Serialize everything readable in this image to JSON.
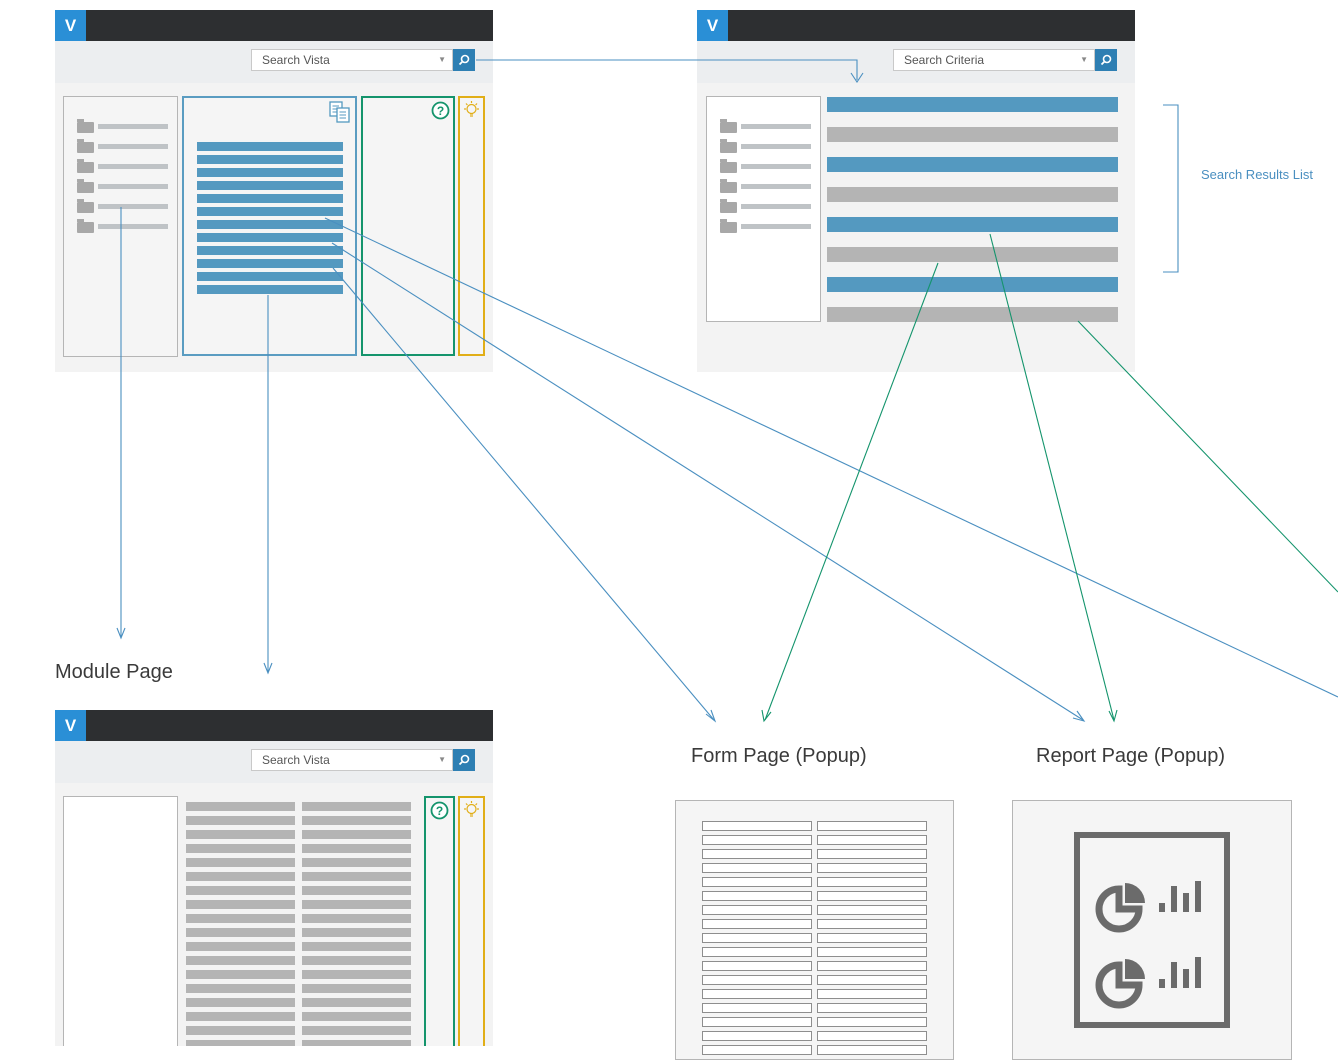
{
  "app": {
    "logo_letter": "V"
  },
  "screens": {
    "main": {
      "search_placeholder": "Search Vista"
    },
    "search": {
      "search_placeholder": "Search Criteria"
    },
    "module": {
      "search_placeholder": "Search Vista"
    }
  },
  "labels": {
    "module_page": "Module Page",
    "form_page": "Form Page (Popup)",
    "report_page": "Report Page (Popup)",
    "search_results_list": "Search Results List"
  },
  "icons": {
    "copy": "copy-pages-icon",
    "help": "help-circle-icon",
    "idea": "lightbulb-icon",
    "search": "magnifier-icon",
    "report": "pie-bar-report-icon"
  },
  "colors": {
    "topbar": "#2d2f31",
    "logo": "#2a8fd6",
    "blue_accent": "#5499c0",
    "green_accent": "#14946c",
    "gold_accent": "#e1ae17",
    "gray_block": "#b4b4b4"
  }
}
